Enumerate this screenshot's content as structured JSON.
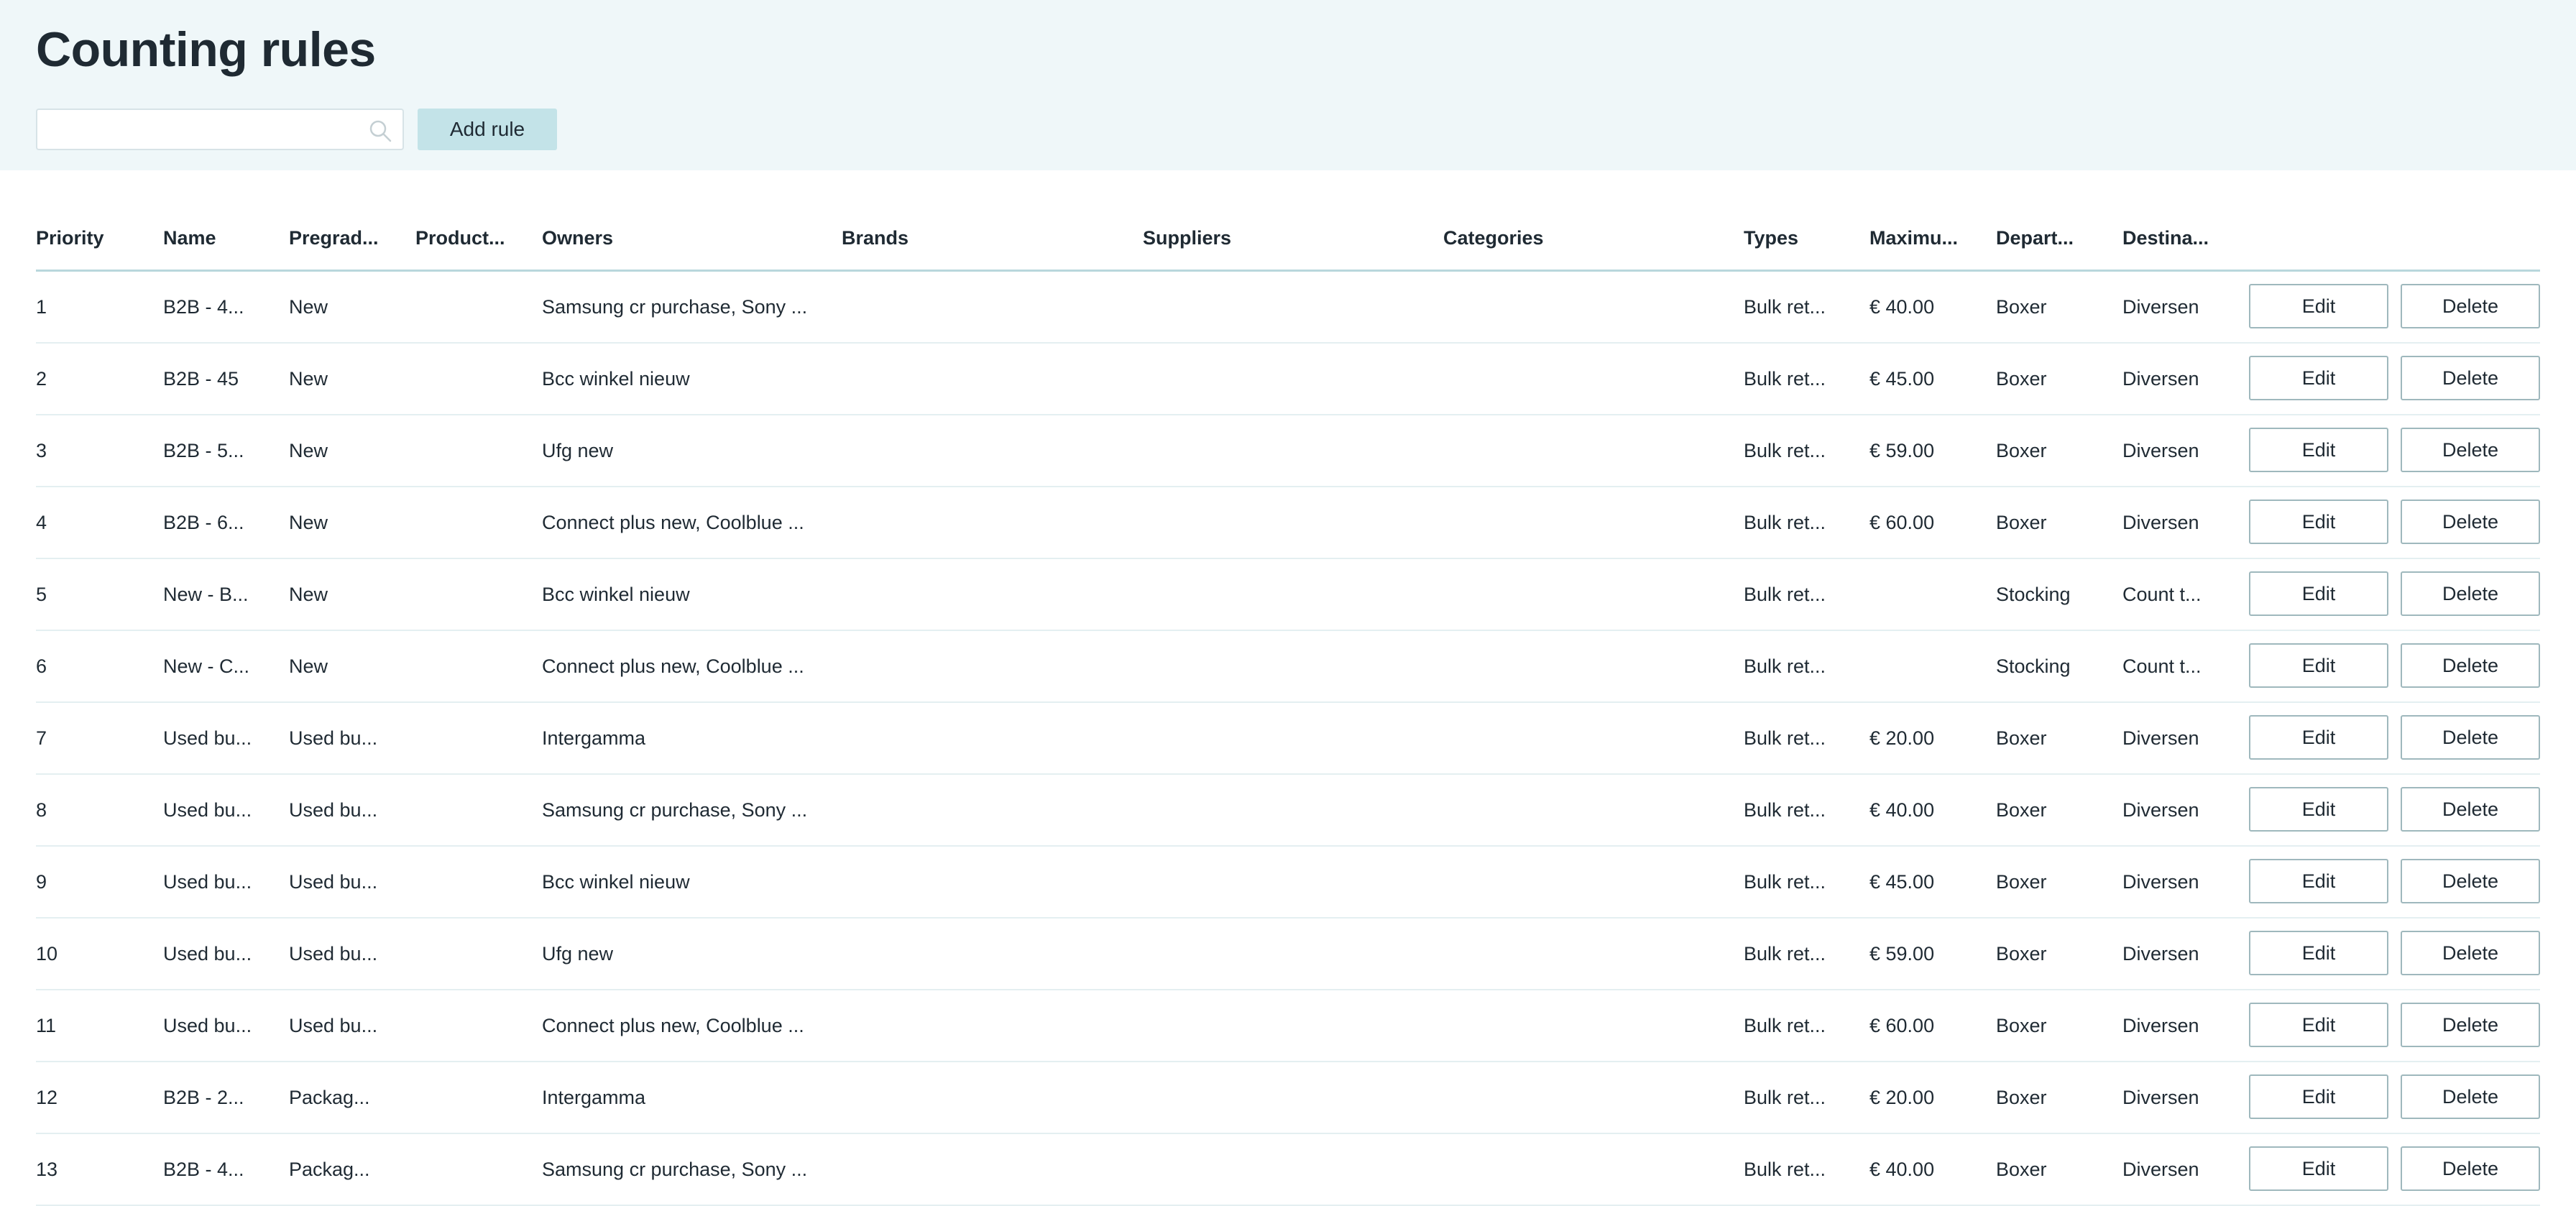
{
  "page": {
    "title": "Counting rules"
  },
  "toolbar": {
    "search_placeholder": "",
    "search_value": "",
    "add_rule_label": "Add rule"
  },
  "table": {
    "columns": [
      "Priority",
      "Name",
      "Pregrad...",
      "Product...",
      "Owners",
      "Brands",
      "Suppliers",
      "Categories",
      "Types",
      "Maximu...",
      "Depart...",
      "Destina..."
    ],
    "edit_label": "Edit",
    "delete_label": "Delete",
    "rows": [
      [
        "1",
        "B2B - 4...",
        "New",
        "",
        "Samsung cr purchase, Sony ...",
        "",
        "",
        "",
        "Bulk ret...",
        "€ 40.00",
        "Boxer",
        "Diversen"
      ],
      [
        "2",
        "B2B - 45",
        "New",
        "",
        "Bcc winkel nieuw",
        "",
        "",
        "",
        "Bulk ret...",
        "€ 45.00",
        "Boxer",
        "Diversen"
      ],
      [
        "3",
        "B2B - 5...",
        "New",
        "",
        "Ufg new",
        "",
        "",
        "",
        "Bulk ret...",
        "€ 59.00",
        "Boxer",
        "Diversen"
      ],
      [
        "4",
        "B2B - 6...",
        "New",
        "",
        "Connect plus new, Coolblue ...",
        "",
        "",
        "",
        "Bulk ret...",
        "€ 60.00",
        "Boxer",
        "Diversen"
      ],
      [
        "5",
        "New - B...",
        "New",
        "",
        "Bcc winkel nieuw",
        "",
        "",
        "",
        "Bulk ret...",
        "",
        "Stocking",
        "Count t..."
      ],
      [
        "6",
        "New - C...",
        "New",
        "",
        "Connect plus new, Coolblue ...",
        "",
        "",
        "",
        "Bulk ret...",
        "",
        "Stocking",
        "Count t..."
      ],
      [
        "7",
        "Used bu...",
        "Used bu...",
        "",
        "Intergamma",
        "",
        "",
        "",
        "Bulk ret...",
        "€ 20.00",
        "Boxer",
        "Diversen"
      ],
      [
        "8",
        "Used bu...",
        "Used bu...",
        "",
        "Samsung cr purchase, Sony ...",
        "",
        "",
        "",
        "Bulk ret...",
        "€ 40.00",
        "Boxer",
        "Diversen"
      ],
      [
        "9",
        "Used bu...",
        "Used bu...",
        "",
        "Bcc winkel nieuw",
        "",
        "",
        "",
        "Bulk ret...",
        "€ 45.00",
        "Boxer",
        "Diversen"
      ],
      [
        "10",
        "Used bu...",
        "Used bu...",
        "",
        "Ufg new",
        "",
        "",
        "",
        "Bulk ret...",
        "€ 59.00",
        "Boxer",
        "Diversen"
      ],
      [
        "11",
        "Used bu...",
        "Used bu...",
        "",
        "Connect plus new, Coolblue ...",
        "",
        "",
        "",
        "Bulk ret...",
        "€ 60.00",
        "Boxer",
        "Diversen"
      ],
      [
        "12",
        "B2B - 2...",
        "Packag...",
        "",
        "Intergamma",
        "",
        "",
        "",
        "Bulk ret...",
        "€ 20.00",
        "Boxer",
        "Diversen"
      ],
      [
        "13",
        "B2B - 4...",
        "Packag...",
        "",
        "Samsung cr purchase, Sony ...",
        "",
        "",
        "",
        "Bulk ret...",
        "€ 40.00",
        "Boxer",
        "Diversen"
      ]
    ]
  }
}
